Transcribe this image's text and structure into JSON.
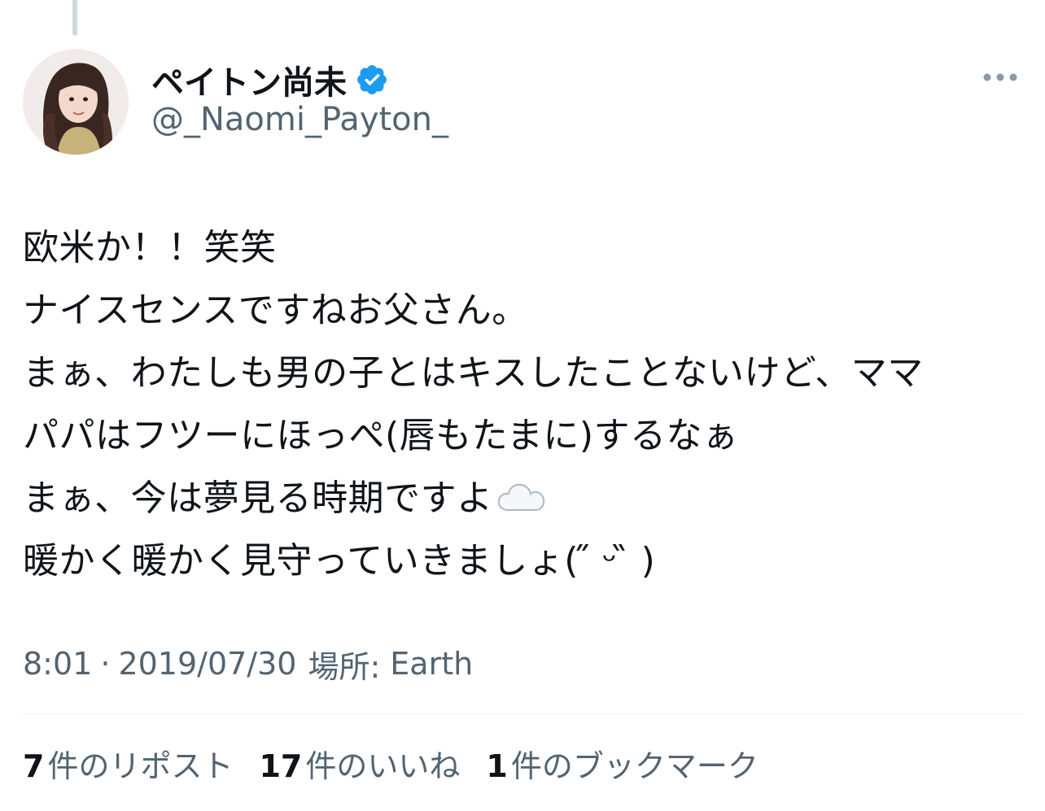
{
  "author": {
    "display_name": "ペイトン尚未",
    "handle": "@_Naomi_Payton_",
    "verified": true,
    "verified_color": "#1d9bf0"
  },
  "tweet": {
    "lines": [
      "欧米か！！笑笑",
      "ナイスセンスですねお父さん。",
      "まぁ、わたしも男の子とはキスしたことないけど、ママ",
      "パパはフツーにほっぺ(唇もたまに)するなぁ",
      "まぁ、今は夢見る時期ですよ",
      "暖かく暖かく見守っていきましょ( ̋ ᵕ ̏ )"
    ],
    "emoji": "cloud"
  },
  "meta": {
    "time": "8:01",
    "separator": "·",
    "date": "2019/07/30",
    "location_label": "場所:",
    "location": "Earth"
  },
  "stats": {
    "reposts_count": "7",
    "reposts_label": "件のリポスト",
    "likes_count": "17",
    "likes_label": "件のいいね",
    "bookmarks_count": "1",
    "bookmarks_label": "件のブックマーク"
  },
  "colors": {
    "text_primary": "#0f1419",
    "text_secondary": "#536471",
    "accent": "#1d9bf0",
    "divider": "#eff3f4"
  }
}
